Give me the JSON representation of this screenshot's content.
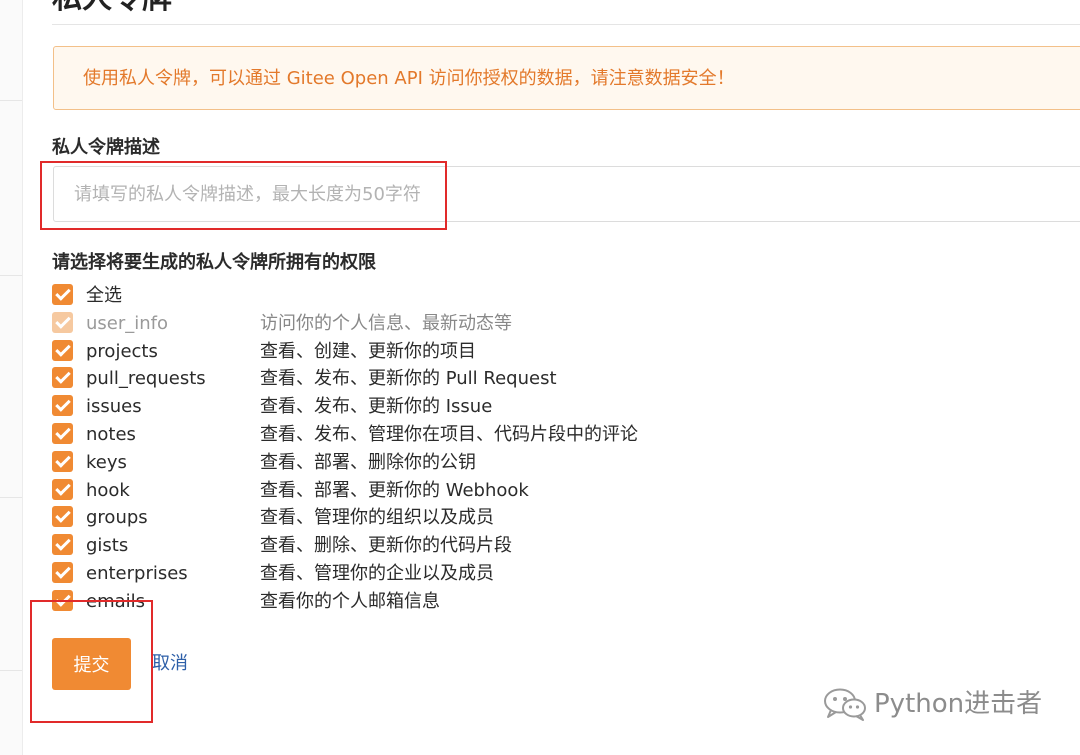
{
  "page": {
    "title": "私人令牌"
  },
  "notice": {
    "text": "使用私人令牌，可以通过 Gitee Open API 访问你授权的数据，请注意数据安全！"
  },
  "description_field": {
    "label": "私人令牌描述",
    "value": "",
    "placeholder": "请填写的私人令牌描述，最大长度为50字符"
  },
  "permissions": {
    "label": "请选择将要生成的私人令牌所拥有的权限",
    "items": [
      {
        "name": "全选",
        "desc": "",
        "checked": true,
        "disabled": false
      },
      {
        "name": "user_info",
        "desc": "访问你的个人信息、最新动态等",
        "checked": true,
        "disabled": true
      },
      {
        "name": "projects",
        "desc": "查看、创建、更新你的项目",
        "checked": true,
        "disabled": false
      },
      {
        "name": "pull_requests",
        "desc": "查看、发布、更新你的 Pull Request",
        "checked": true,
        "disabled": false
      },
      {
        "name": "issues",
        "desc": "查看、发布、更新你的 Issue",
        "checked": true,
        "disabled": false
      },
      {
        "name": "notes",
        "desc": "查看、发布、管理你在项目、代码片段中的评论",
        "checked": true,
        "disabled": false
      },
      {
        "name": "keys",
        "desc": "查看、部署、删除你的公钥",
        "checked": true,
        "disabled": false
      },
      {
        "name": "hook",
        "desc": "查看、部署、更新你的 Webhook",
        "checked": true,
        "disabled": false
      },
      {
        "name": "groups",
        "desc": "查看、管理你的组织以及成员",
        "checked": true,
        "disabled": false
      },
      {
        "name": "gists",
        "desc": "查看、删除、更新你的代码片段",
        "checked": true,
        "disabled": false
      },
      {
        "name": "enterprises",
        "desc": "查看、管理你的企业以及成员",
        "checked": true,
        "disabled": false
      },
      {
        "name": "emails",
        "desc": "查看你的个人邮箱信息",
        "checked": true,
        "disabled": false
      }
    ]
  },
  "actions": {
    "submit_label": "提交",
    "cancel_label": "取消"
  },
  "watermark": {
    "text": "Python进击者",
    "icon": "wechat-icon"
  },
  "colors": {
    "accent": "#f08a33",
    "notice_text": "#e3792b",
    "notice_bg": "#fff8ef",
    "notice_border": "#f3c089",
    "link": "#2d5fa8",
    "highlight_box": "#e12a2a"
  }
}
